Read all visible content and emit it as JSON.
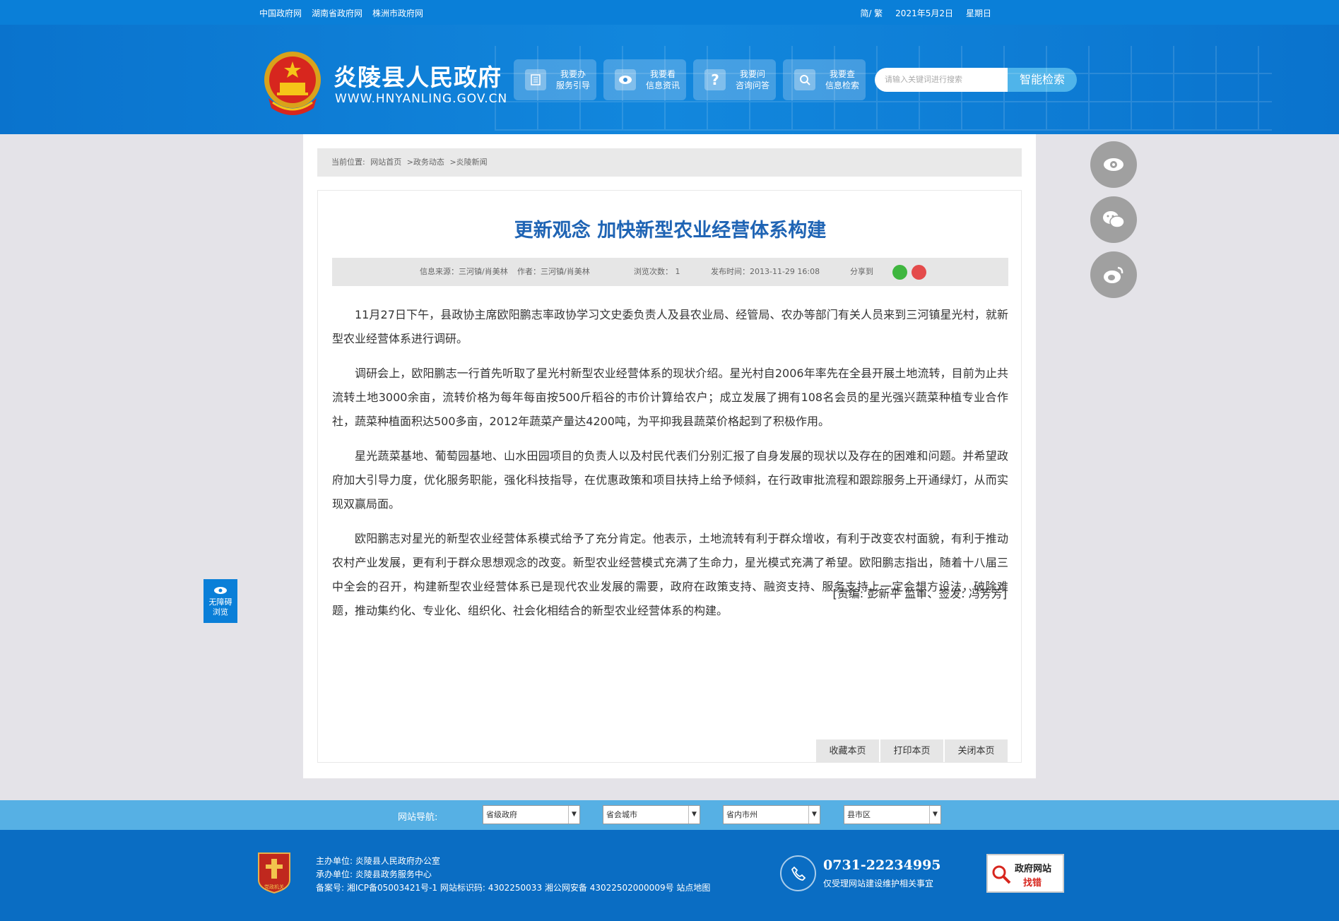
{
  "topbar": {
    "links": [
      "中国政府网",
      "湖南省政府网",
      "株洲市政府网"
    ],
    "lang": "简/ 繁",
    "date": "2021年5月2日",
    "weekday": "星期日"
  },
  "header": {
    "title": "炎陵县人民政府",
    "url": "WWW.HNYANLING.GOV.CN",
    "services": [
      {
        "line1": "我要办",
        "line2": "服务引导",
        "icon": "document-icon"
      },
      {
        "line1": "我要看",
        "line2": "信息资讯",
        "icon": "eye-icon"
      },
      {
        "line1": "我要问",
        "line2": "咨询问答",
        "icon": "question-icon"
      },
      {
        "line1": "我要查",
        "line2": "信息检索",
        "icon": "search-icon"
      }
    ],
    "search_placeholder": "请输入关键词进行搜索",
    "search_button": "智能检索"
  },
  "breadcrumb": {
    "label": "当前位置:",
    "items": [
      "网站首页",
      ">政务动态",
      ">炎陵新闻"
    ]
  },
  "article": {
    "title": "更新观念 加快新型农业经营体系构建",
    "meta": {
      "source": "信息来源：三河镇/肖美林",
      "author": "作者：三河镇/肖美林",
      "views": "浏览次数：  1",
      "published": "发布时间：2013-11-29 16:08",
      "share": "分享到"
    },
    "paragraphs": [
      "11月27日下午，县政协主席欧阳鹏志率政协学习文史委负责人及县农业局、经管局、农办等部门有关人员来到三河镇星光村，就新型农业经营体系进行调研。",
      "调研会上，欧阳鹏志一行首先听取了星光村新型农业经营体系的现状介绍。星光村自2006年率先在全县开展土地流转，目前为止共流转土地3000余亩，流转价格为每年每亩按500斤稻谷的市价计算给农户；成立发展了拥有108名会员的星光强兴蔬菜种植专业合作社，蔬菜种植面积达500多亩，2012年蔬菜产量达4200吨，为平抑我县蔬菜价格起到了积极作用。",
      "星光蔬菜基地、葡萄园基地、山水田园项目的负责人以及村民代表们分别汇报了自身发展的现状以及存在的困难和问题。并希望政府加大引导力度，优化服务职能，强化科技指导，在优惠政策和项目扶持上给予倾斜，在行政审批流程和跟踪服务上开通绿灯，从而实现双赢局面。",
      "欧阳鹏志对星光的新型农业经营体系模式给予了充分肯定。他表示，土地流转有利于群众增收，有利于改变农村面貌，有利于推动农村产业发展，更有利于群众思想观念的改变。新型农业经营模式充满了生命力，星光模式充满了希望。欧阳鹏志指出，随着十八届三中全会的召开，构建新型农业经营体系已是现代农业发展的需要，政府在政策支持、融资支持、服务支持上一定会想方设法，破除难题，推动集约化、专业化、组织化、社会化相结合的新型农业经营体系的构建。"
    ],
    "editor": "[责编: 彭新平  监审、签发: 冯芳芳]",
    "actions": [
      "收藏本页",
      "打印本页",
      "关闭本页"
    ]
  },
  "accessibility": {
    "line1": "无障碍",
    "line2": "浏览"
  },
  "site_nav": {
    "label": "网站导航:",
    "selects": [
      "省级政府",
      "省会城市",
      "省内市州",
      "县市区"
    ]
  },
  "footer": {
    "sponsor": "主办单位: 炎陵县人民政府办公室",
    "organizer": "承办单位: 炎陵县政务服务中心",
    "record": "备案号: 湘ICP备05003421号-1 网站标识码: 4302250033 湘公网安备 43022502000009号 站点地图",
    "badge_text": "党政机关",
    "phone": "0731-22234995",
    "phone_desc": "仅受理网站建设维护相关事宜",
    "gov_err_line1": "政府网站",
    "gov_err_line2": "找错"
  },
  "colors": {
    "primary": "#0a7fd8",
    "title": "#1f64b4",
    "nav": "#56b0e4",
    "footer": "#0a6dc3"
  }
}
